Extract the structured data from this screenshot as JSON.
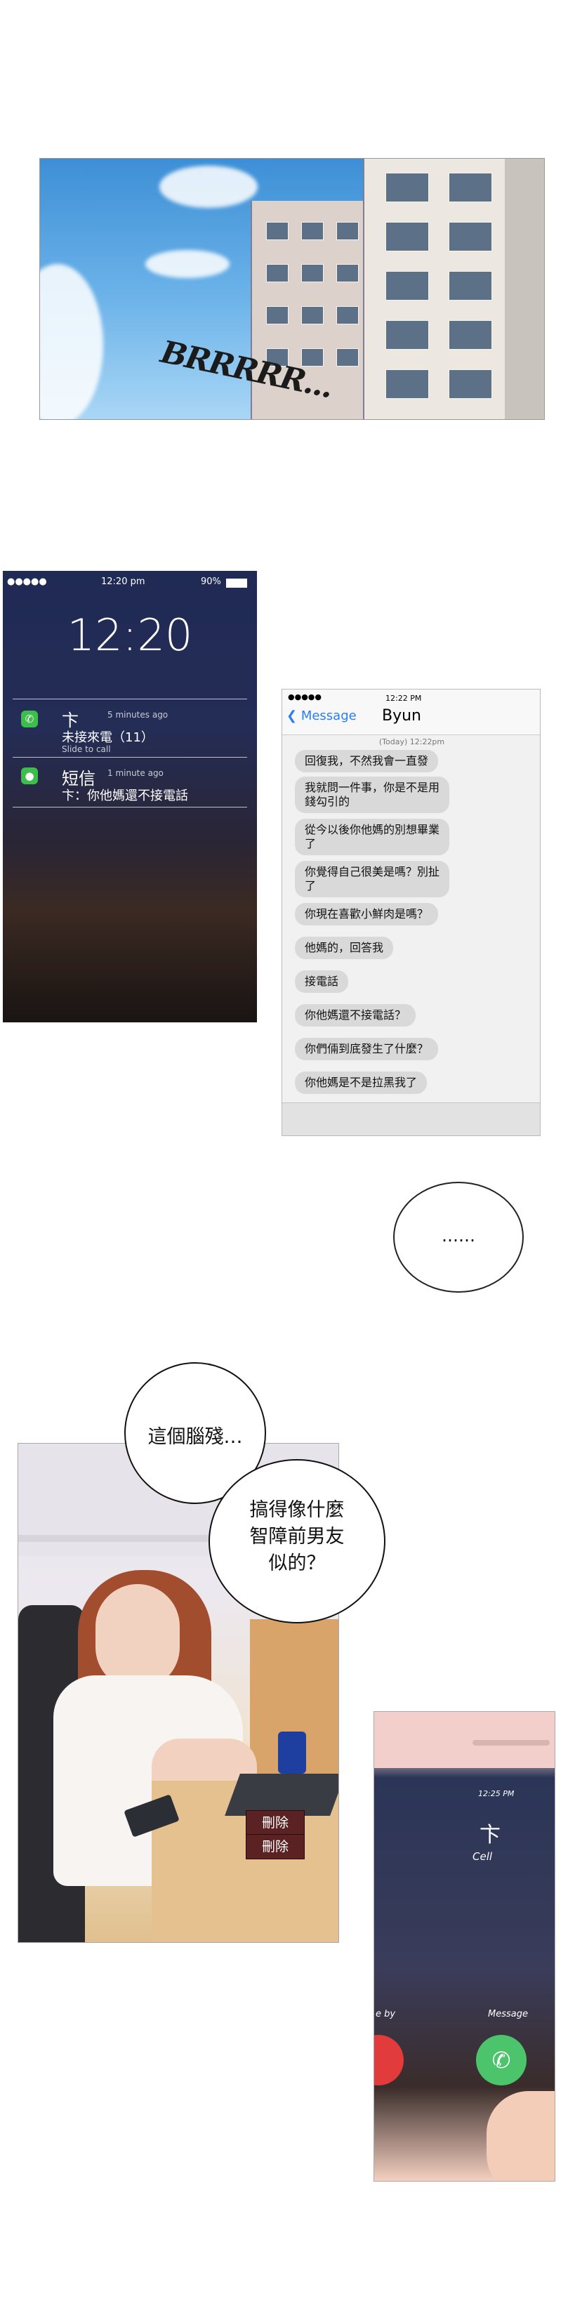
{
  "panel_sky": {
    "sfx": "BRRRRR..."
  },
  "lock_screen": {
    "status_left": "●●●●● ",
    "status_time": "12:20 pm",
    "status_battery": "90%",
    "clock": "12:20",
    "notifications": [
      {
        "title": "卞",
        "time": "5 minutes ago",
        "body": "未接來電（11）",
        "sub": "Slide to call",
        "icon": "phone-icon"
      },
      {
        "title": "短信",
        "time": "1 minute ago",
        "body": "卞：你他媽還不接電話",
        "sub": "",
        "icon": "message-icon"
      }
    ]
  },
  "chat": {
    "status_left": "●●●●● ",
    "status_time": "12:22 PM",
    "back_label": "Message",
    "contact": "Byun",
    "date": "(Today) 12:22pm",
    "messages": [
      "回復我，不然我會一直發",
      "我就問一件事，你是不是用\n錢勾引的",
      "從今以後你他媽的別想畢業\n了",
      "你覺得自己很美是嗎？別扯\n了",
      "你現在喜歡小鮮肉是嗎？",
      "他媽的，回答我",
      "接電話",
      "你他媽還不接電話？",
      "你們倆到底發生了什麼？",
      "你他媽是不是拉黑我了"
    ]
  },
  "ellipsis": "……",
  "girl_panel": {
    "speech_1": "這個腦殘…",
    "speech_2": "搞得像什麼\n智障前男友\n似的？",
    "delete_1": "刪除",
    "delete_2": "刪除"
  },
  "call": {
    "time": "12:25 PM",
    "name": "卞",
    "sub": "Cell",
    "left_label": "e by",
    "right_label": "Message"
  }
}
